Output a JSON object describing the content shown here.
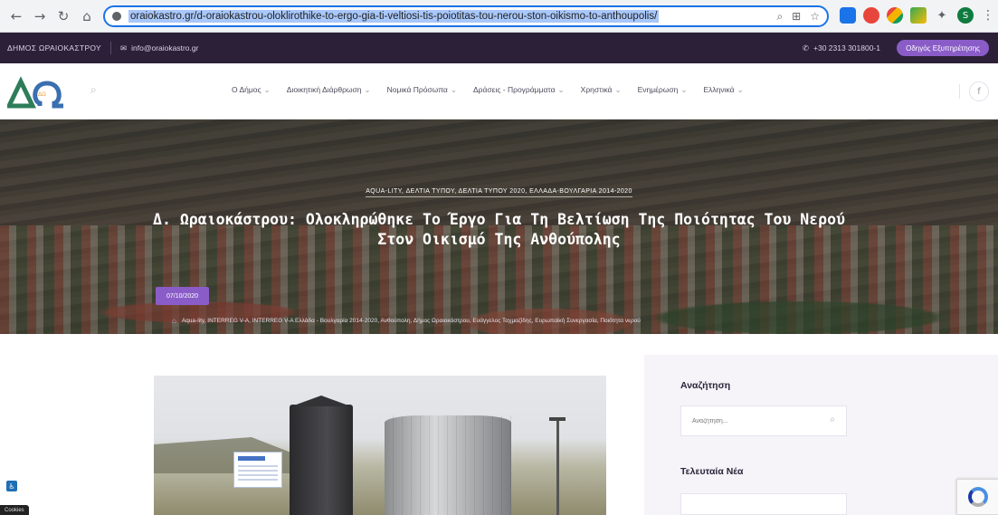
{
  "browser": {
    "url": "oraiokastro.gr/d-oraiokastrou-oloklirothike-to-ergo-gia-ti-veltiosi-tis-poiotitas-tou-nerou-ston-oikismo-to-anthoupolis/",
    "back_icon": "back-arrow-icon",
    "forward_icon": "forward-arrow-icon",
    "reload_icon": "reload-icon",
    "home_icon": "home-icon"
  },
  "topbar": {
    "municipality": "ΔΗΜΟΣ ΩΡΑΙΟΚΑΣΤΡΟΥ",
    "email": "info@oraiokastro.gr",
    "phone": "+30 2313 301800-1",
    "cta": "Οδηγός Εξυπηρέτησης"
  },
  "header": {
    "logo_text": "ΔΩ",
    "menu": [
      {
        "label": "Ο Δήμος"
      },
      {
        "label": "Διοικητική Διάρθρωση"
      },
      {
        "label": "Νομικά Πρόσωπα"
      },
      {
        "label": "Δράσεις - Προγράμματα"
      },
      {
        "label": "Χρηστικά"
      },
      {
        "label": "Ενημέρωση"
      },
      {
        "label": "Ελληνικά"
      }
    ]
  },
  "hero": {
    "categories": "AQUA-LITY, ΔΕΛΤΙΑ ΤΥΠΟΥ, ΔΕΛΤΙΑ ΤΥΠΟΥ 2020, ΕΛΛΑΔΑ-ΒΟΥΛΓΑΡΙΑ 2014-2020",
    "title": "Δ. Ωραιοκάστρου: Ολοκληρώθηκε Το Έργο Για Τη Βελτίωση Της Ποιότητας Του Νερού Στον Οικισμό Της Ανθούπολης",
    "date": "07/10/2020",
    "tags": "Aqua-lity, INTERREG V-A, INTERREG V-A Ελλάδα - Βουλγαρία 2014-2020, Ανθούπολη, Δήμος Ωραιοκάστρου, Ευάγγελος Ταχμαζίδης, Ευρωπαϊκή Συνεργασία, Ποιότητα νερού"
  },
  "sidebar": {
    "search_heading": "Αναζήτηση",
    "search_placeholder": "Αναζήτηση...",
    "news_heading": "Τελευταία Νέα"
  },
  "footer_bits": {
    "cookies": "Cookies"
  },
  "colors": {
    "accent": "#8a5cc8",
    "topbar_bg": "#2b2037",
    "url_highlight": "#a8c7fa"
  }
}
